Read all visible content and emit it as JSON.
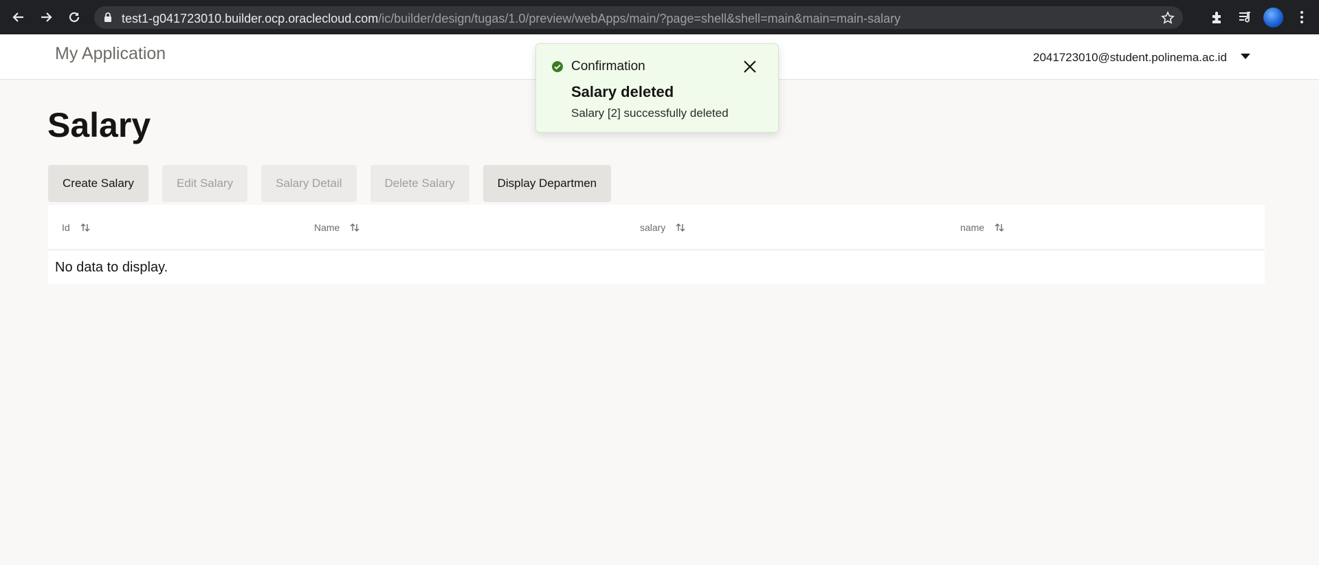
{
  "browser": {
    "url_host": "test1-g041723010.builder.ocp.oraclecloud.com",
    "url_path": "/ic/builder/design/tugas/1.0/preview/webApps/main/?page=shell&shell=main&main=main-salary",
    "icons": [
      "back-icon",
      "forward-icon",
      "reload-icon",
      "lock-icon",
      "star-icon",
      "extensions-icon",
      "media-icon",
      "profile-avatar",
      "menu-icon"
    ]
  },
  "header": {
    "app_title": "My Application",
    "user": "2041723010@student.polinema.ac.id"
  },
  "page": {
    "title": "Salary"
  },
  "toolbar": {
    "create": "Create Salary",
    "edit": "Edit Salary",
    "detail": "Salary Detail",
    "delete": "Delete Salary",
    "display": "Display Departmen"
  },
  "table": {
    "columns": [
      "Id",
      "Name",
      "salary",
      "name"
    ],
    "empty_text": "No data to display."
  },
  "toast": {
    "label": "Confirmation",
    "heading": "Salary deleted",
    "message": "Salary [2] successfully deleted",
    "color": "#f0fbec"
  }
}
